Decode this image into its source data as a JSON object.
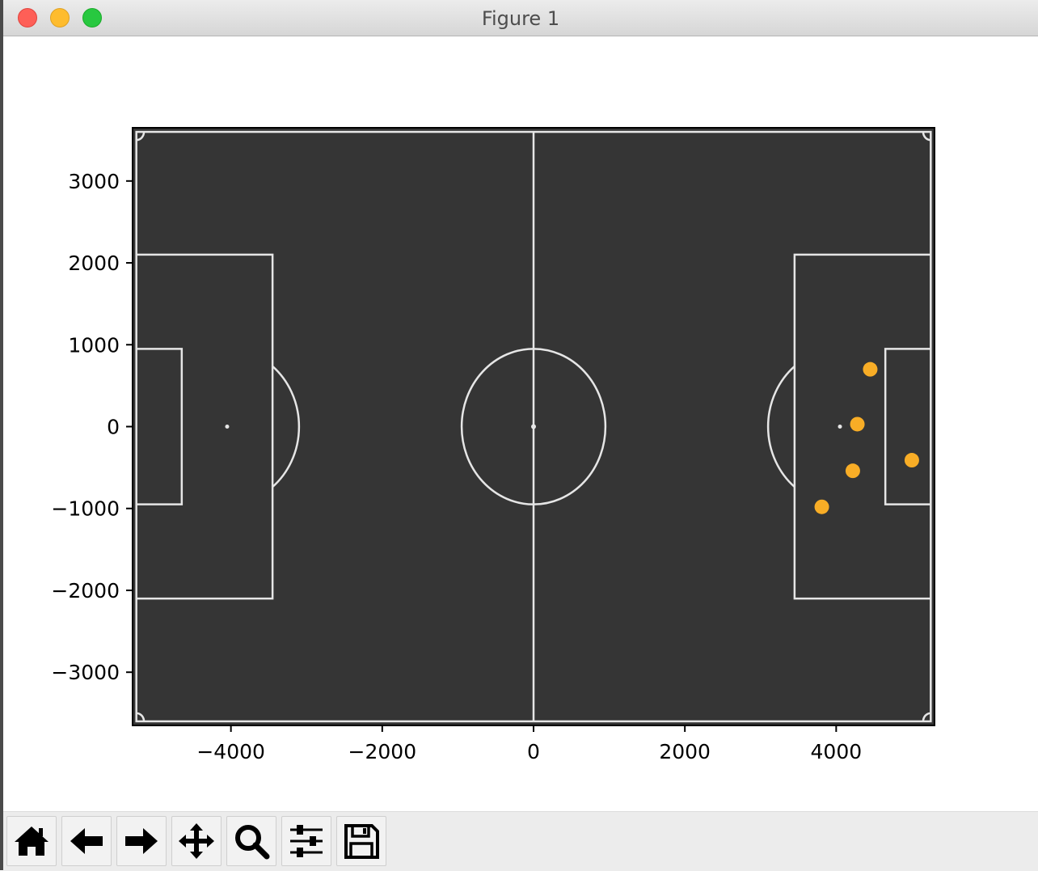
{
  "window": {
    "title": "Figure 1"
  },
  "toolbar": {
    "buttons": [
      {
        "name": "home-button",
        "icon": "home-icon"
      },
      {
        "name": "back-button",
        "icon": "arrow-left-icon"
      },
      {
        "name": "forward-button",
        "icon": "arrow-right-icon"
      },
      {
        "name": "pan-button",
        "icon": "move-icon"
      },
      {
        "name": "zoom-button",
        "icon": "magnifier-icon"
      },
      {
        "name": "configure-subplots-button",
        "icon": "sliders-icon"
      },
      {
        "name": "save-button",
        "icon": "floppy-disk-icon"
      }
    ]
  },
  "chart_data": {
    "type": "scatter",
    "title": "",
    "xlabel": "",
    "ylabel": "",
    "xlim": [
      -5300,
      5300
    ],
    "ylim": [
      -3650,
      3650
    ],
    "x_ticks": [
      -4000,
      -2000,
      0,
      2000,
      4000
    ],
    "x_tick_labels": [
      "−4000",
      "−2000",
      "0",
      "2000",
      "4000"
    ],
    "y_ticks": [
      3000,
      2000,
      1000,
      0,
      -1000,
      -2000,
      -3000
    ],
    "y_tick_labels": [
      "3000",
      "2000",
      "1000",
      "0",
      "−1000",
      "−2000",
      "−3000"
    ],
    "grid": false,
    "background_color": "#353535",
    "line_color": "#e6e6e6",
    "pitch": {
      "half_length": 5250,
      "half_width": 3600,
      "penalty_area_x": 3450,
      "penalty_area_half_width": 2100,
      "goal_area_x": 4650,
      "goal_area_half_width": 950,
      "penalty_spot_x": 4050,
      "center_circle_radius": 950,
      "corner_arc_radius": 100
    },
    "series": [
      {
        "color": "#f8ad26",
        "points": [
          {
            "x": 4450,
            "y": 700
          },
          {
            "x": 4280,
            "y": 30
          },
          {
            "x": 5000,
            "y": -410
          },
          {
            "x": 4220,
            "y": -540
          },
          {
            "x": 3810,
            "y": -980
          }
        ]
      }
    ]
  }
}
